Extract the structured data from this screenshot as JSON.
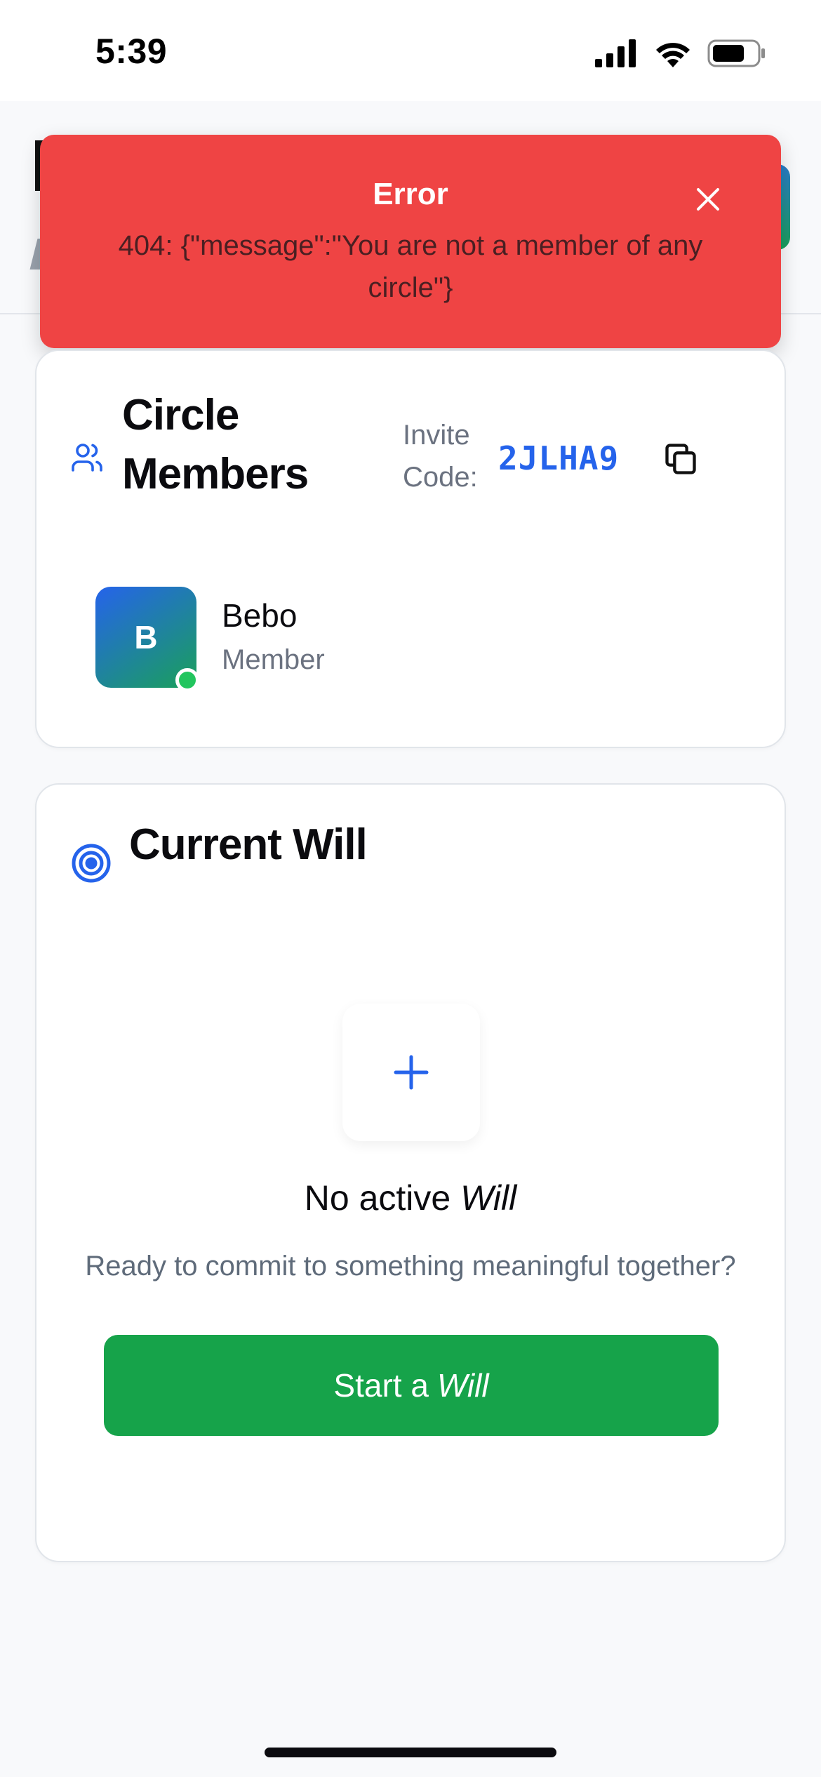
{
  "status_bar": {
    "time": "5:39",
    "icons": [
      "cellular-signal-icon",
      "wifi-icon",
      "battery-icon"
    ]
  },
  "toast": {
    "title": "Error",
    "message": "404: {\"message\":\"You are not a member of any circle\"}",
    "close_icon": "close-icon",
    "background": "#ef4444"
  },
  "members": {
    "title": "Circle Members",
    "invite_label": "Invite Code:",
    "invite_code": "2JLHA9",
    "copy_icon": "copy-icon",
    "items": [
      {
        "initial": "B",
        "name": "Bebo",
        "role": "Member",
        "online": true
      }
    ]
  },
  "will": {
    "title": "Current Will",
    "add_icon": "plus-icon",
    "empty_prefix": "No active",
    "empty_emphasis": "Will",
    "empty_subtitle": "Ready to commit to something meaningful together?",
    "button_prefix": "Start a",
    "button_emphasis": "Will"
  },
  "colors": {
    "accent": "#2563eb",
    "success": "#16a34a",
    "error": "#ef4444",
    "online": "#22c55e"
  }
}
